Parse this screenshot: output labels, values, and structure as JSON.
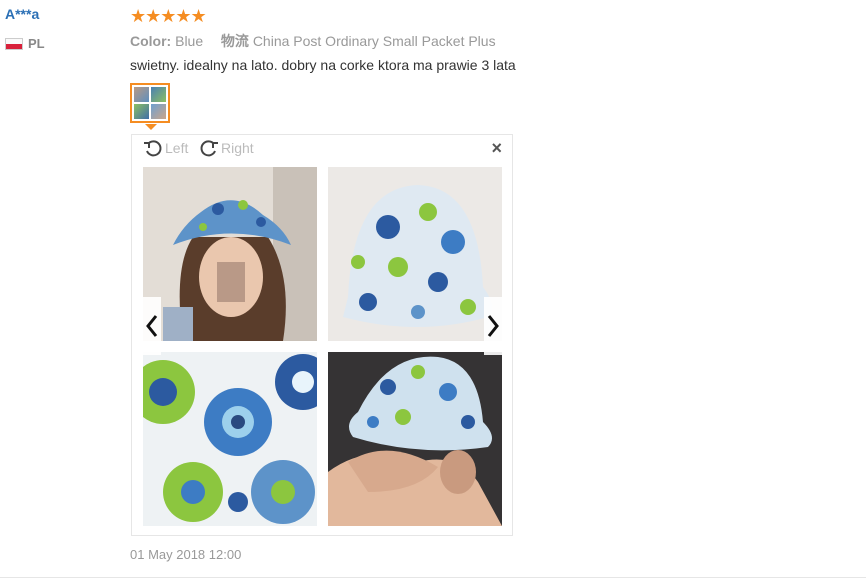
{
  "review": {
    "user_name": "A***a",
    "country": "PL",
    "stars": "★★★★★",
    "color_label": "Color:",
    "color_value": "Blue",
    "shipping_label": "物流",
    "shipping_value": "China Post Ordinary Small Packet Plus",
    "text": "swietny. idealny na lato. dobry na corke ktora ma prawie 3 lata",
    "date": "01 May 2018 12:00"
  },
  "viewer": {
    "rotate_left_label": "Left",
    "rotate_right_label": "Right",
    "close_glyph": "×"
  },
  "icons": {
    "rotate_left": "rotate-left-icon",
    "rotate_right": "rotate-right-icon",
    "close": "close-icon",
    "prev": "chevron-left-icon",
    "next": "chevron-right-icon"
  },
  "colors": {
    "accent": "#f58d22",
    "username": "#2a6fb5",
    "muted": "#999999"
  }
}
